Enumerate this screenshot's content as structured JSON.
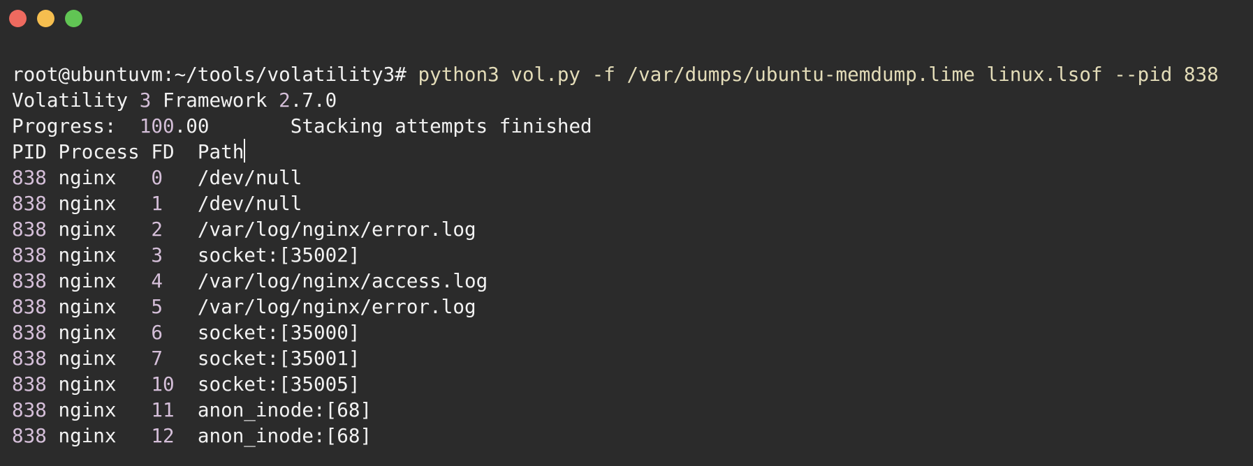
{
  "window": {
    "controls": [
      "close",
      "minimize",
      "maximize"
    ]
  },
  "prompt": "root@ubuntuvm:~/tools/volatility3#",
  "command": "python3 vol.py -f /var/dumps/ubuntu-memdump.lime linux.lsof --pid 838",
  "banner": {
    "name": "Volatility",
    "version_major": "3",
    "framework": "Framework",
    "version": "2.7.0"
  },
  "progress": {
    "label": "Progress:",
    "value": "100.00",
    "status": "Stacking attempts finished"
  },
  "table": {
    "headers": [
      "PID",
      "Process",
      "FD",
      "Path"
    ],
    "rows": [
      {
        "pid": "838",
        "process": "nginx",
        "fd": "0",
        "path": "/dev/null"
      },
      {
        "pid": "838",
        "process": "nginx",
        "fd": "1",
        "path": "/dev/null"
      },
      {
        "pid": "838",
        "process": "nginx",
        "fd": "2",
        "path": "/var/log/nginx/error.log"
      },
      {
        "pid": "838",
        "process": "nginx",
        "fd": "3",
        "path": "socket:[35002]"
      },
      {
        "pid": "838",
        "process": "nginx",
        "fd": "4",
        "path": "/var/log/nginx/access.log"
      },
      {
        "pid": "838",
        "process": "nginx",
        "fd": "5",
        "path": "/var/log/nginx/error.log"
      },
      {
        "pid": "838",
        "process": "nginx",
        "fd": "6",
        "path": "socket:[35000]"
      },
      {
        "pid": "838",
        "process": "nginx",
        "fd": "7",
        "path": "socket:[35001]"
      },
      {
        "pid": "838",
        "process": "nginx",
        "fd": "10",
        "path": "socket:[35005]"
      },
      {
        "pid": "838",
        "process": "nginx",
        "fd": "11",
        "path": "anon_inode:[68]"
      },
      {
        "pid": "838",
        "process": "nginx",
        "fd": "12",
        "path": "anon_inode:[68]"
      }
    ]
  },
  "colors": {
    "background": "#2b2b2b",
    "text": "#f2f2f2",
    "command": "#e3dcb8",
    "number": "#d5bfd9"
  }
}
